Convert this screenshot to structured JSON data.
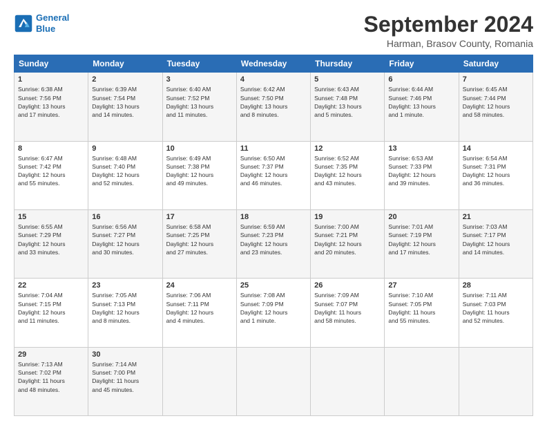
{
  "header": {
    "logo_line1": "General",
    "logo_line2": "Blue",
    "main_title": "September 2024",
    "subtitle": "Harman, Brasov County, Romania"
  },
  "weekdays": [
    "Sunday",
    "Monday",
    "Tuesday",
    "Wednesday",
    "Thursday",
    "Friday",
    "Saturday"
  ],
  "weeks": [
    [
      {
        "day": "1",
        "sunrise": "6:38 AM",
        "sunset": "7:56 PM",
        "daylight": "13 hours and 17 minutes."
      },
      {
        "day": "2",
        "sunrise": "6:39 AM",
        "sunset": "7:54 PM",
        "daylight": "13 hours and 14 minutes."
      },
      {
        "day": "3",
        "sunrise": "6:40 AM",
        "sunset": "7:52 PM",
        "daylight": "13 hours and 11 minutes."
      },
      {
        "day": "4",
        "sunrise": "6:42 AM",
        "sunset": "7:50 PM",
        "daylight": "13 hours and 8 minutes."
      },
      {
        "day": "5",
        "sunrise": "6:43 AM",
        "sunset": "7:48 PM",
        "daylight": "13 hours and 5 minutes."
      },
      {
        "day": "6",
        "sunrise": "6:44 AM",
        "sunset": "7:46 PM",
        "daylight": "13 hours and 1 minute."
      },
      {
        "day": "7",
        "sunrise": "6:45 AM",
        "sunset": "7:44 PM",
        "daylight": "12 hours and 58 minutes."
      }
    ],
    [
      {
        "day": "8",
        "sunrise": "6:47 AM",
        "sunset": "7:42 PM",
        "daylight": "12 hours and 55 minutes."
      },
      {
        "day": "9",
        "sunrise": "6:48 AM",
        "sunset": "7:40 PM",
        "daylight": "12 hours and 52 minutes."
      },
      {
        "day": "10",
        "sunrise": "6:49 AM",
        "sunset": "7:38 PM",
        "daylight": "12 hours and 49 minutes."
      },
      {
        "day": "11",
        "sunrise": "6:50 AM",
        "sunset": "7:37 PM",
        "daylight": "12 hours and 46 minutes."
      },
      {
        "day": "12",
        "sunrise": "6:52 AM",
        "sunset": "7:35 PM",
        "daylight": "12 hours and 43 minutes."
      },
      {
        "day": "13",
        "sunrise": "6:53 AM",
        "sunset": "7:33 PM",
        "daylight": "12 hours and 39 minutes."
      },
      {
        "day": "14",
        "sunrise": "6:54 AM",
        "sunset": "7:31 PM",
        "daylight": "12 hours and 36 minutes."
      }
    ],
    [
      {
        "day": "15",
        "sunrise": "6:55 AM",
        "sunset": "7:29 PM",
        "daylight": "12 hours and 33 minutes."
      },
      {
        "day": "16",
        "sunrise": "6:56 AM",
        "sunset": "7:27 PM",
        "daylight": "12 hours and 30 minutes."
      },
      {
        "day": "17",
        "sunrise": "6:58 AM",
        "sunset": "7:25 PM",
        "daylight": "12 hours and 27 minutes."
      },
      {
        "day": "18",
        "sunrise": "6:59 AM",
        "sunset": "7:23 PM",
        "daylight": "12 hours and 23 minutes."
      },
      {
        "day": "19",
        "sunrise": "7:00 AM",
        "sunset": "7:21 PM",
        "daylight": "12 hours and 20 minutes."
      },
      {
        "day": "20",
        "sunrise": "7:01 AM",
        "sunset": "7:19 PM",
        "daylight": "12 hours and 17 minutes."
      },
      {
        "day": "21",
        "sunrise": "7:03 AM",
        "sunset": "7:17 PM",
        "daylight": "12 hours and 14 minutes."
      }
    ],
    [
      {
        "day": "22",
        "sunrise": "7:04 AM",
        "sunset": "7:15 PM",
        "daylight": "12 hours and 11 minutes."
      },
      {
        "day": "23",
        "sunrise": "7:05 AM",
        "sunset": "7:13 PM",
        "daylight": "12 hours and 8 minutes."
      },
      {
        "day": "24",
        "sunrise": "7:06 AM",
        "sunset": "7:11 PM",
        "daylight": "12 hours and 4 minutes."
      },
      {
        "day": "25",
        "sunrise": "7:08 AM",
        "sunset": "7:09 PM",
        "daylight": "12 hours and 1 minute."
      },
      {
        "day": "26",
        "sunrise": "7:09 AM",
        "sunset": "7:07 PM",
        "daylight": "11 hours and 58 minutes."
      },
      {
        "day": "27",
        "sunrise": "7:10 AM",
        "sunset": "7:05 PM",
        "daylight": "11 hours and 55 minutes."
      },
      {
        "day": "28",
        "sunrise": "7:11 AM",
        "sunset": "7:03 PM",
        "daylight": "11 hours and 52 minutes."
      }
    ],
    [
      {
        "day": "29",
        "sunrise": "7:13 AM",
        "sunset": "7:02 PM",
        "daylight": "11 hours and 48 minutes."
      },
      {
        "day": "30",
        "sunrise": "7:14 AM",
        "sunset": "7:00 PM",
        "daylight": "11 hours and 45 minutes."
      },
      null,
      null,
      null,
      null,
      null
    ]
  ]
}
